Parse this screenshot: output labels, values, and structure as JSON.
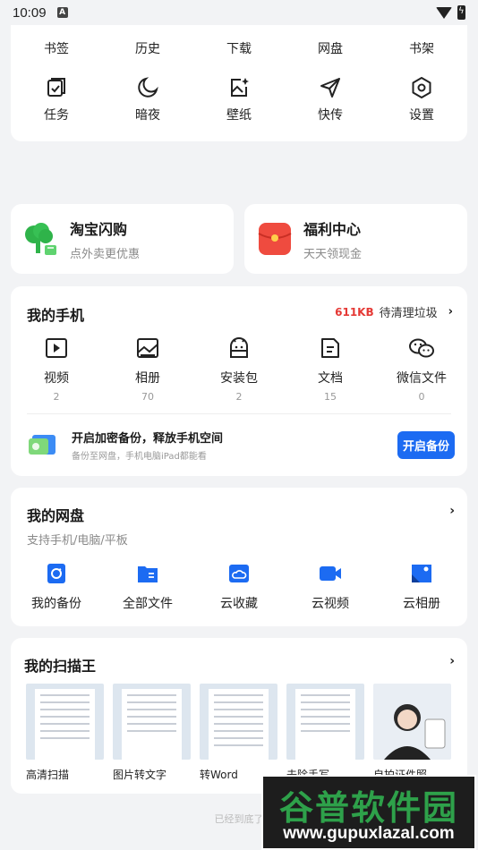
{
  "status": {
    "time": "10:09"
  },
  "tools": {
    "top_row": [
      "书签",
      "历史",
      "下载",
      "网盘",
      "书架"
    ],
    "bottom_row": [
      {
        "label": "任务",
        "icon": "task-icon"
      },
      {
        "label": "暗夜",
        "icon": "moon-icon"
      },
      {
        "label": "壁纸",
        "icon": "wallpaper-icon"
      },
      {
        "label": "快传",
        "icon": "send-icon"
      },
      {
        "label": "设置",
        "icon": "settings-icon"
      }
    ]
  },
  "promos": {
    "left": {
      "title": "淘宝闪购",
      "subtitle": "点外卖更优惠",
      "icon": "tree-shop-icon"
    },
    "right": {
      "title": "福利中心",
      "subtitle": "天天领现金",
      "icon": "red-envelope-icon"
    }
  },
  "my_phone": {
    "title": "我的手机",
    "junk_size": "611KB",
    "junk_label": "待清理垃圾",
    "categories": [
      {
        "name": "视频",
        "count": "2",
        "icon": "video-icon"
      },
      {
        "name": "相册",
        "count": "70",
        "icon": "album-icon"
      },
      {
        "name": "安装包",
        "count": "2",
        "icon": "android-package-icon"
      },
      {
        "name": "文档",
        "count": "15",
        "icon": "document-icon"
      },
      {
        "name": "微信文件",
        "count": "0",
        "icon": "wechat-icon"
      }
    ],
    "backup_title": "开启加密备份，释放手机空间",
    "backup_subtitle": "备份至网盘，手机电脑iPad都能看",
    "backup_button": "开启备份"
  },
  "my_cloud": {
    "title": "我的网盘",
    "subtitle": "支持手机/电脑/平板",
    "categories": [
      {
        "name": "我的备份",
        "icon": "backup-icon"
      },
      {
        "name": "全部文件",
        "icon": "folder-icon"
      },
      {
        "name": "云收藏",
        "icon": "cloud-collect-icon"
      },
      {
        "name": "云视频",
        "icon": "cloud-video-icon"
      },
      {
        "name": "云相册",
        "icon": "cloud-album-icon"
      }
    ]
  },
  "scanner": {
    "title": "我的扫描王",
    "items": [
      "高清扫描",
      "图片转文字",
      "转Word",
      "去除手写",
      "自拍证件照"
    ]
  },
  "footer": "已经到底了",
  "watermark": {
    "cn": "谷普软件园",
    "url": "www.gupuxlazal.com"
  },
  "colors": {
    "accent": "#1c6bf2",
    "junk": "#e53935",
    "watermark_green": "#2ea14a"
  }
}
